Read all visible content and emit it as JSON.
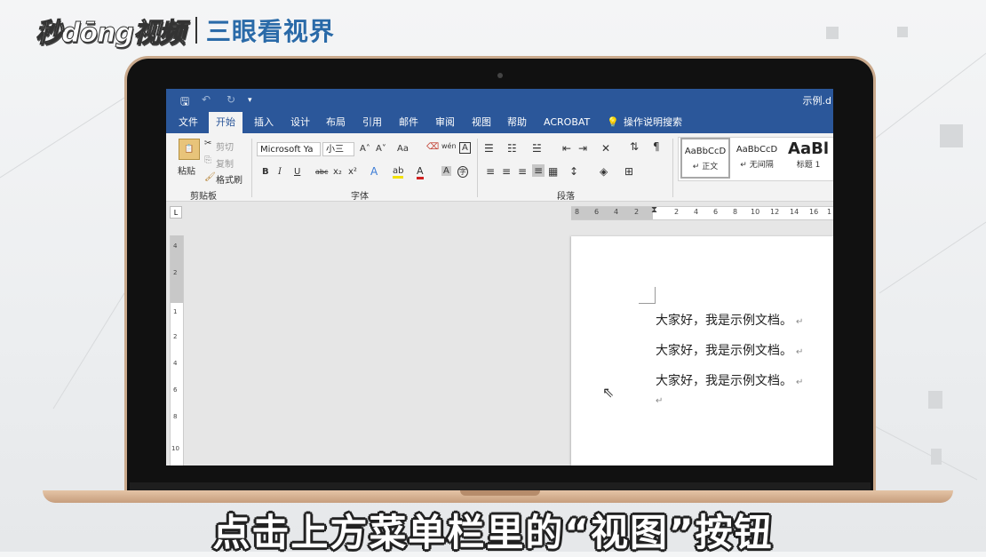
{
  "watermark": {
    "logo": "秒dōng视频",
    "brand": "三眼看视界"
  },
  "window": {
    "doc_title": "示例.d"
  },
  "quick_access": {
    "save": "🖫",
    "undo": "↶",
    "redo": "↻",
    "customize": "▾"
  },
  "tabs": [
    "文件",
    "开始",
    "插入",
    "设计",
    "布局",
    "引用",
    "邮件",
    "审阅",
    "视图",
    "帮助",
    "ACROBAT"
  ],
  "tell_me": "操作说明搜索",
  "ribbon": {
    "clipboard": {
      "paste": "粘贴",
      "cut": "剪切",
      "copy": "复制",
      "format_painter": "格式刷",
      "label": "剪贴板"
    },
    "font": {
      "name": "Microsoft Ya",
      "size": "小三",
      "label": "字体",
      "bold": "B",
      "italic": "I",
      "underline": "U",
      "strike": "abc",
      "sub": "x₂",
      "sup": "x²",
      "grow": "A˄",
      "shrink": "A˅",
      "case": "Aa",
      "effects": "A",
      "highlight": "ab",
      "color": "A",
      "shade": "A",
      "phonetic": "wén",
      "border": "A",
      "enclose": "字"
    },
    "paragraph": {
      "label": "段落"
    },
    "styles": [
      {
        "preview": "AaBbCcD",
        "name": "↵ 正文"
      },
      {
        "preview": "AaBbCcD",
        "name": "↵ 无间隔"
      },
      {
        "preview": "AaBl",
        "name": "标题 1"
      }
    ]
  },
  "ruler": {
    "corner": "L",
    "h_ticks": [
      "8",
      "6",
      "4",
      "2",
      "",
      "2",
      "4",
      "6",
      "8",
      "10",
      "12",
      "14",
      "16",
      "1"
    ],
    "v_ticks": [
      "4",
      "2",
      "1",
      "2",
      "4",
      "6",
      "8",
      "10"
    ]
  },
  "document": {
    "lines": [
      "大家好，我是示例文档。",
      "大家好，我是示例文档。",
      "大家好，我是示例文档。"
    ],
    "mark": "↵"
  },
  "subtitle": "点击上方菜单栏里的“视图”按钮"
}
